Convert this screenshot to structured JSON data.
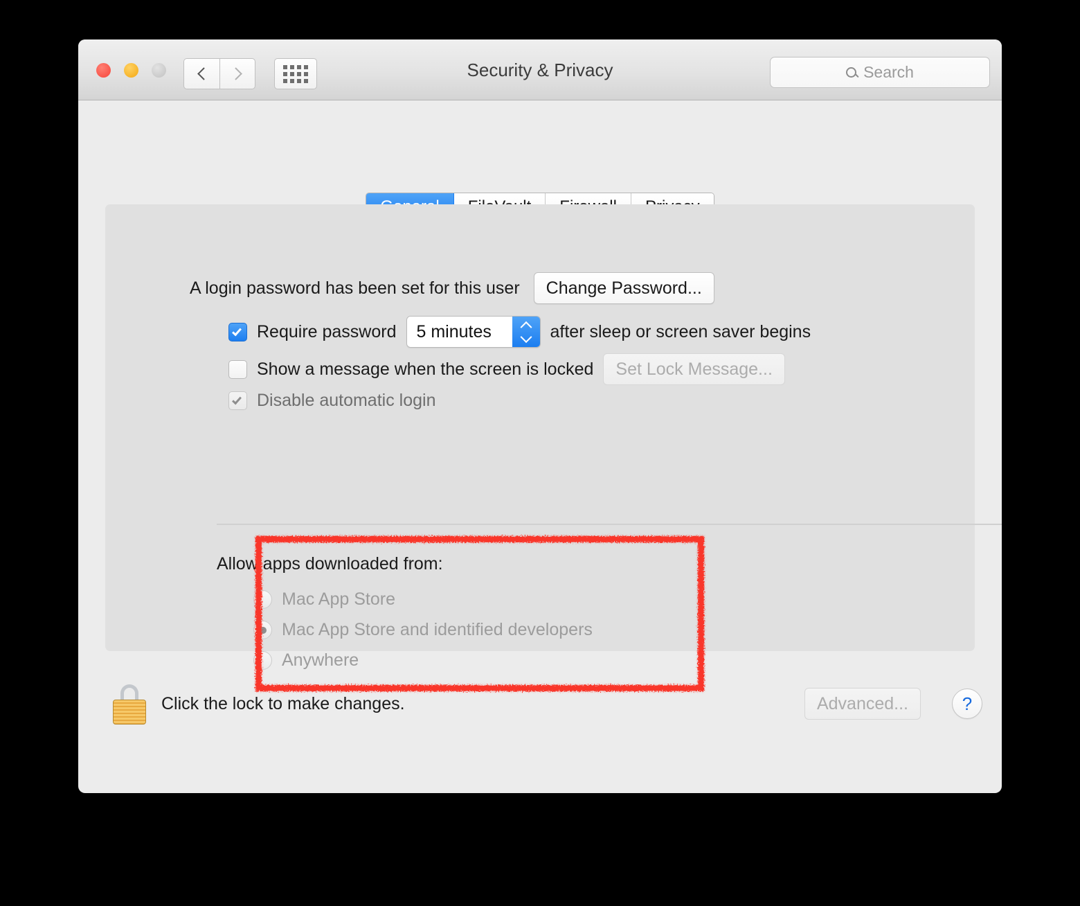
{
  "window": {
    "title": "Security & Privacy",
    "traffic_lights": [
      "close",
      "minimize",
      "zoom"
    ],
    "nav": {
      "back": "back-arrow",
      "forward": "forward-arrow",
      "grid": "show-all-grid"
    },
    "search": {
      "placeholder": "Search",
      "value": "",
      "icon": "search-icon"
    }
  },
  "tabs": [
    {
      "label": "General",
      "active": true
    },
    {
      "label": "FileVault",
      "active": false
    },
    {
      "label": "Firewall",
      "active": false
    },
    {
      "label": "Privacy",
      "active": false
    }
  ],
  "general": {
    "password_status": "A login password has been set for this user",
    "change_password_button": "Change Password...",
    "require_password": {
      "label": "Require password",
      "checked": true,
      "enabled": true,
      "delay_value": "5 minutes",
      "suffix": "after sleep or screen saver begins"
    },
    "lock_message": {
      "label": "Show a message when the screen is locked",
      "checked": false,
      "enabled": true,
      "button": "Set Lock Message...",
      "button_enabled": false
    },
    "disable_auto_login": {
      "label": "Disable automatic login",
      "checked": true,
      "enabled": false
    }
  },
  "gatekeeper": {
    "heading": "Allow apps downloaded from:",
    "enabled": false,
    "options": [
      {
        "label": "Mac App Store",
        "selected": false
      },
      {
        "label": "Mac App Store and identified developers",
        "selected": true
      },
      {
        "label": "Anywhere",
        "selected": false
      }
    ]
  },
  "footer": {
    "lock_icon": "closed-padlock-icon",
    "lock_text": "Click the lock to make changes.",
    "advanced_button": "Advanced...",
    "advanced_enabled": false,
    "help_button": "?"
  },
  "annotation": {
    "shape": "rough-rectangle",
    "color": "#F9372A",
    "targets": "gatekeeper"
  },
  "colors": {
    "accent_blue": "#1C7EF0",
    "window_bg": "#ECECEC",
    "panel_bg": "#E0E0E0",
    "annotation_red": "#F9372A",
    "lock_gold": "#E8A93F",
    "help_blue": "#1569DE"
  }
}
